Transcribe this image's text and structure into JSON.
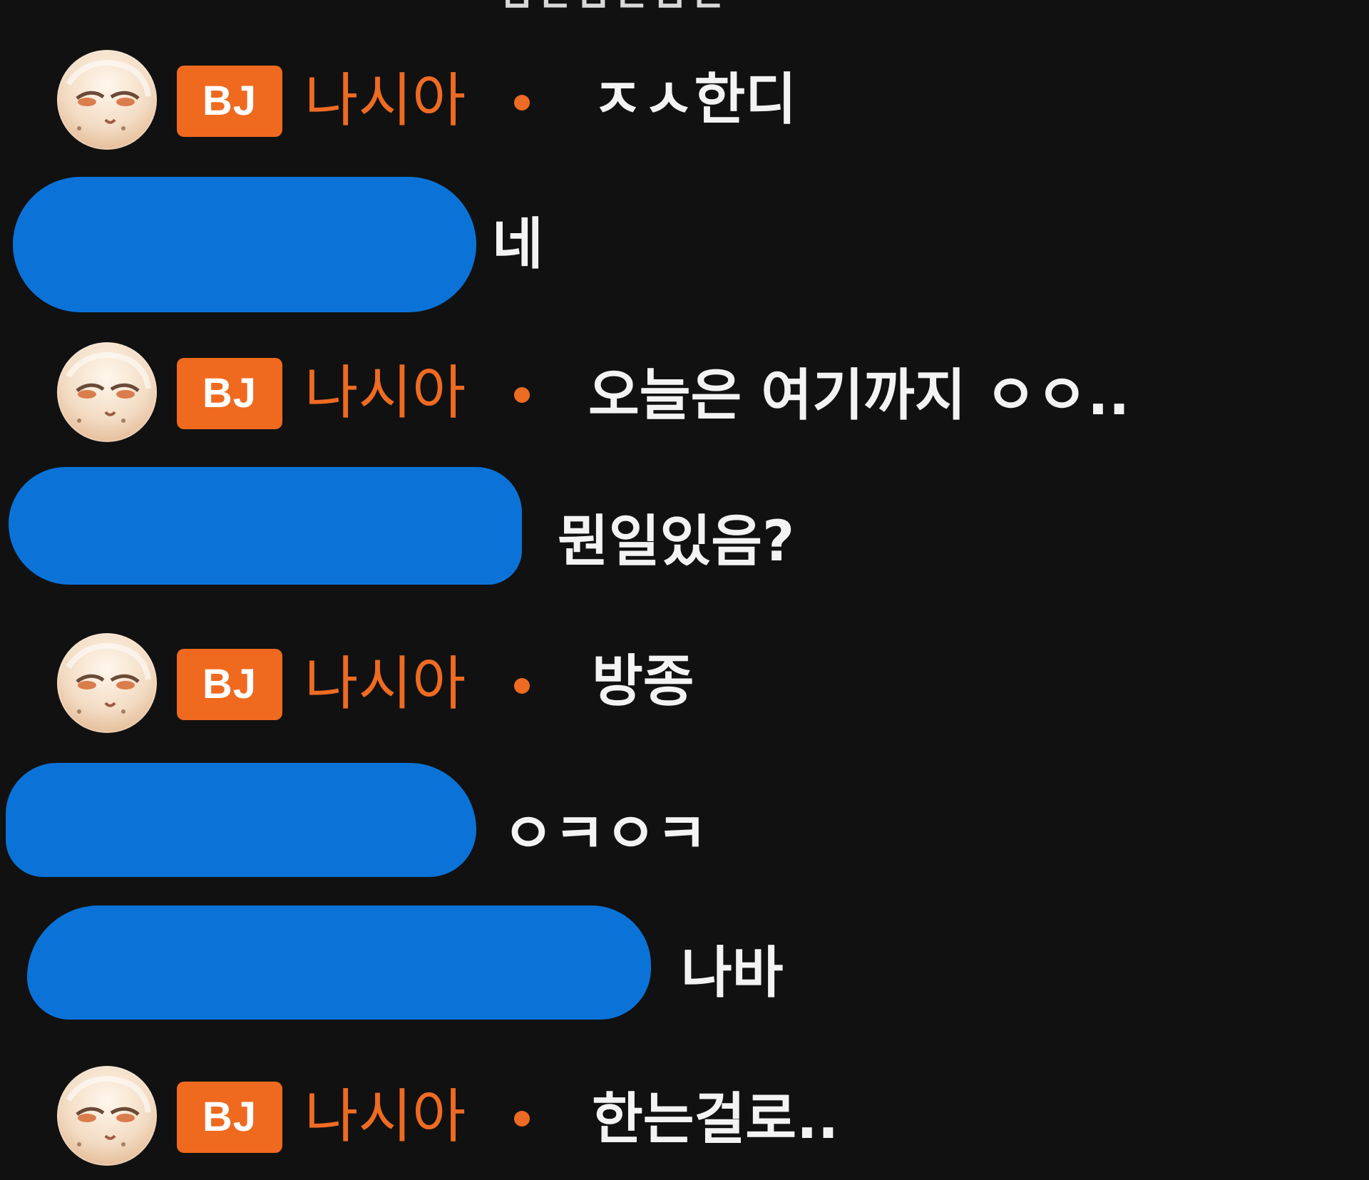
{
  "chat": {
    "top_fragment": "ㅂㄷㅂㄷㅂㄷ",
    "messages": [
      {
        "role": "bj",
        "badge": "BJ",
        "name": "나시아",
        "text": "ㅈㅅ한디"
      },
      {
        "role": "viewer",
        "text": "네"
      },
      {
        "role": "bj",
        "badge": "BJ",
        "name": "나시아",
        "text": "오늘은 여기까지 ㅇㅇ.."
      },
      {
        "role": "viewer",
        "text": "뭔일있음?"
      },
      {
        "role": "bj",
        "badge": "BJ",
        "name": "나시아",
        "text": "방종"
      },
      {
        "role": "viewer",
        "text": "ㅇㅋㅇㅋ"
      },
      {
        "role": "viewer",
        "text": "나바"
      },
      {
        "role": "bj",
        "badge": "BJ",
        "name": "나시아",
        "text": "한는걸로.."
      }
    ]
  },
  "colors": {
    "background": "#111111",
    "bj_badge": "#ef6a1f",
    "bj_name": "#ee6b23",
    "message_text": "#f3f3f3",
    "redaction_blue": "#0b73d8"
  }
}
